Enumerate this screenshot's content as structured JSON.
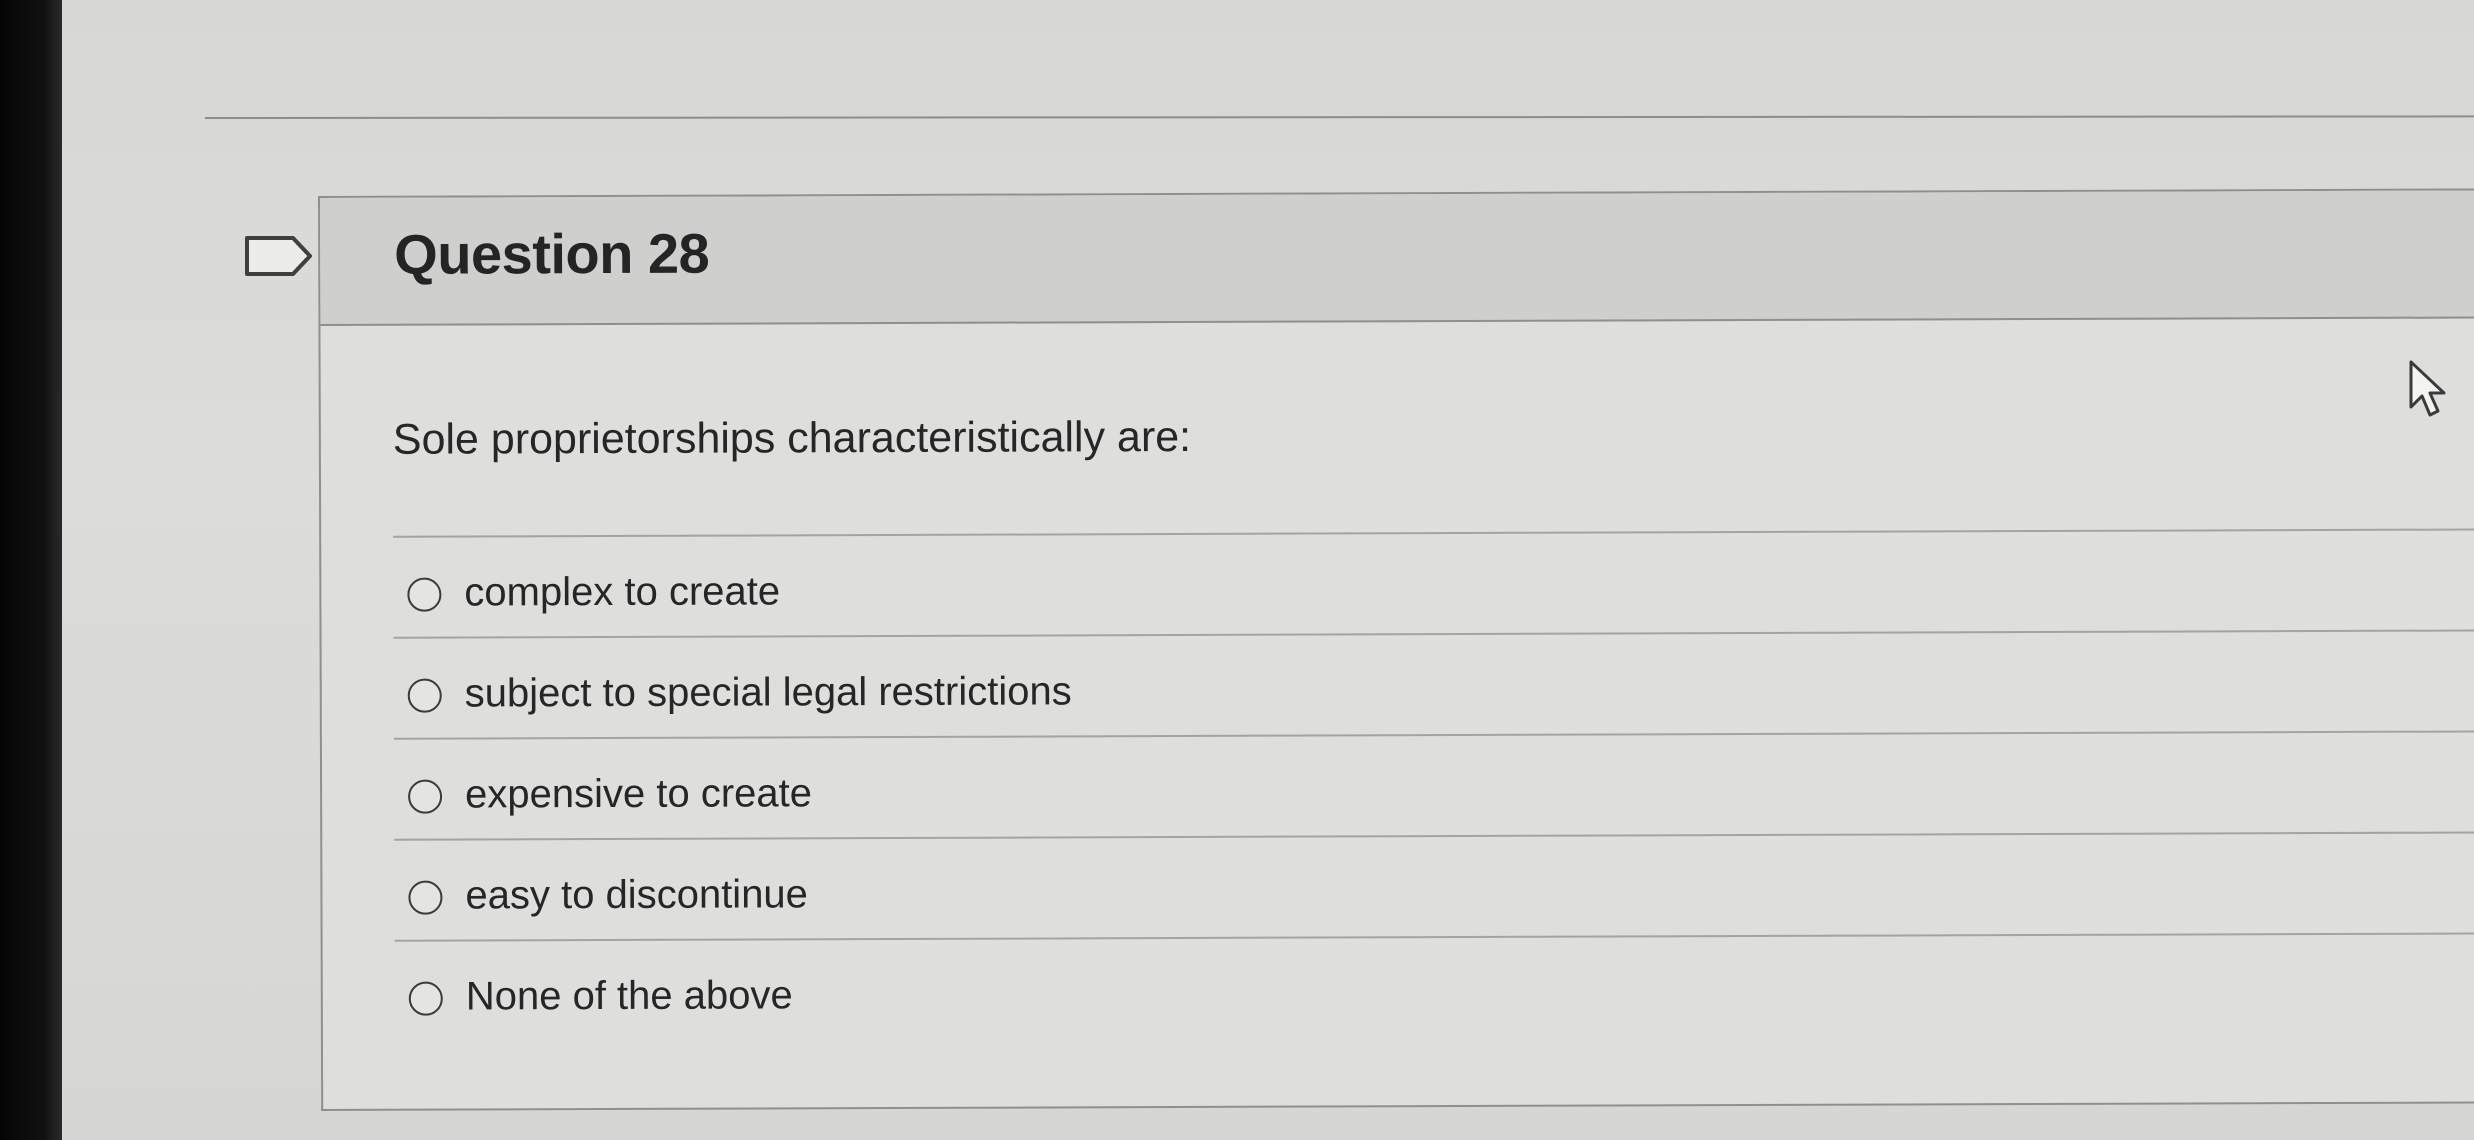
{
  "question": {
    "title": "Question 28",
    "prompt": "Sole proprietorships characteristically are:",
    "answers": [
      {
        "label": "complex to create"
      },
      {
        "label": "subject to special legal restrictions"
      },
      {
        "label": "expensive to create"
      },
      {
        "label": "easy to discontinue"
      },
      {
        "label": "None of the above"
      }
    ]
  },
  "icons": {
    "flag": "flag-question-icon",
    "cursor": "mouse-pointer-icon"
  },
  "colors": {
    "page_background": "#dcdcda",
    "header_background": "#cfcfcd",
    "text": "#262626",
    "divider": "#8f8f8d"
  }
}
